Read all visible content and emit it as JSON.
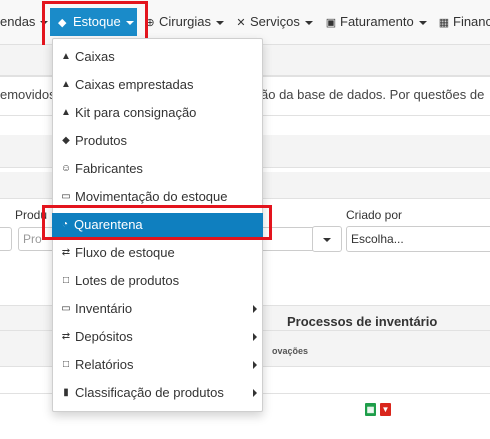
{
  "navbar": {
    "items": [
      {
        "label": "endas",
        "icon": "none"
      },
      {
        "label": "Estoque",
        "icon": "tag-icon",
        "active": true
      },
      {
        "label": "Cirurgias",
        "icon": "plus-circle-icon"
      },
      {
        "label": "Serviços",
        "icon": "wrench-icon"
      },
      {
        "label": "Faturamento",
        "icon": "shopping-cart-icon"
      },
      {
        "label": "Financ",
        "icon": "table-icon"
      }
    ]
  },
  "page": {
    "alert_left": "emovidos",
    "alert_right": "ão da base de dados. Por questões de",
    "filters": {
      "produto_label": "Produ",
      "produto_placeholder": "Pro",
      "criado_por_label": "Criado por",
      "criado_por_value": "Escolha..."
    },
    "table": {
      "title": "Processos de inventário",
      "subheader": "ovações"
    }
  },
  "dropdown": {
    "items": [
      {
        "label": "Caixas",
        "icon": "bank-icon"
      },
      {
        "label": "Caixas emprestadas",
        "icon": "bank-icon"
      },
      {
        "label": "Kit para consignação",
        "icon": "bank-icon"
      },
      {
        "label": "Produtos",
        "icon": "tag-icon"
      },
      {
        "label": "Fabricantes",
        "icon": "user-icon"
      },
      {
        "label": "Movimentação do estoque",
        "icon": "clipboard-icon"
      },
      {
        "label": "Quarentena",
        "icon": "clock-icon",
        "selected": true
      },
      {
        "label": "Fluxo de estoque",
        "icon": "exchange-icon"
      },
      {
        "label": "Lotes de produtos",
        "icon": "file-icon"
      },
      {
        "label": "Inventário",
        "icon": "clipboard-icon",
        "submenu": true
      },
      {
        "label": "Depósitos",
        "icon": "exchange-icon",
        "submenu": true
      },
      {
        "label": "Relatórios",
        "icon": "file-icon",
        "submenu": true
      },
      {
        "label": "Classificação de produtos",
        "icon": "barcode-icon",
        "submenu": true
      }
    ]
  },
  "colors": {
    "accent": "#1a8bc9",
    "selected": "#0f7fbf",
    "highlight_box": "#e3141d",
    "excel": "#1e9e4a",
    "pdf": "#d9261c"
  }
}
